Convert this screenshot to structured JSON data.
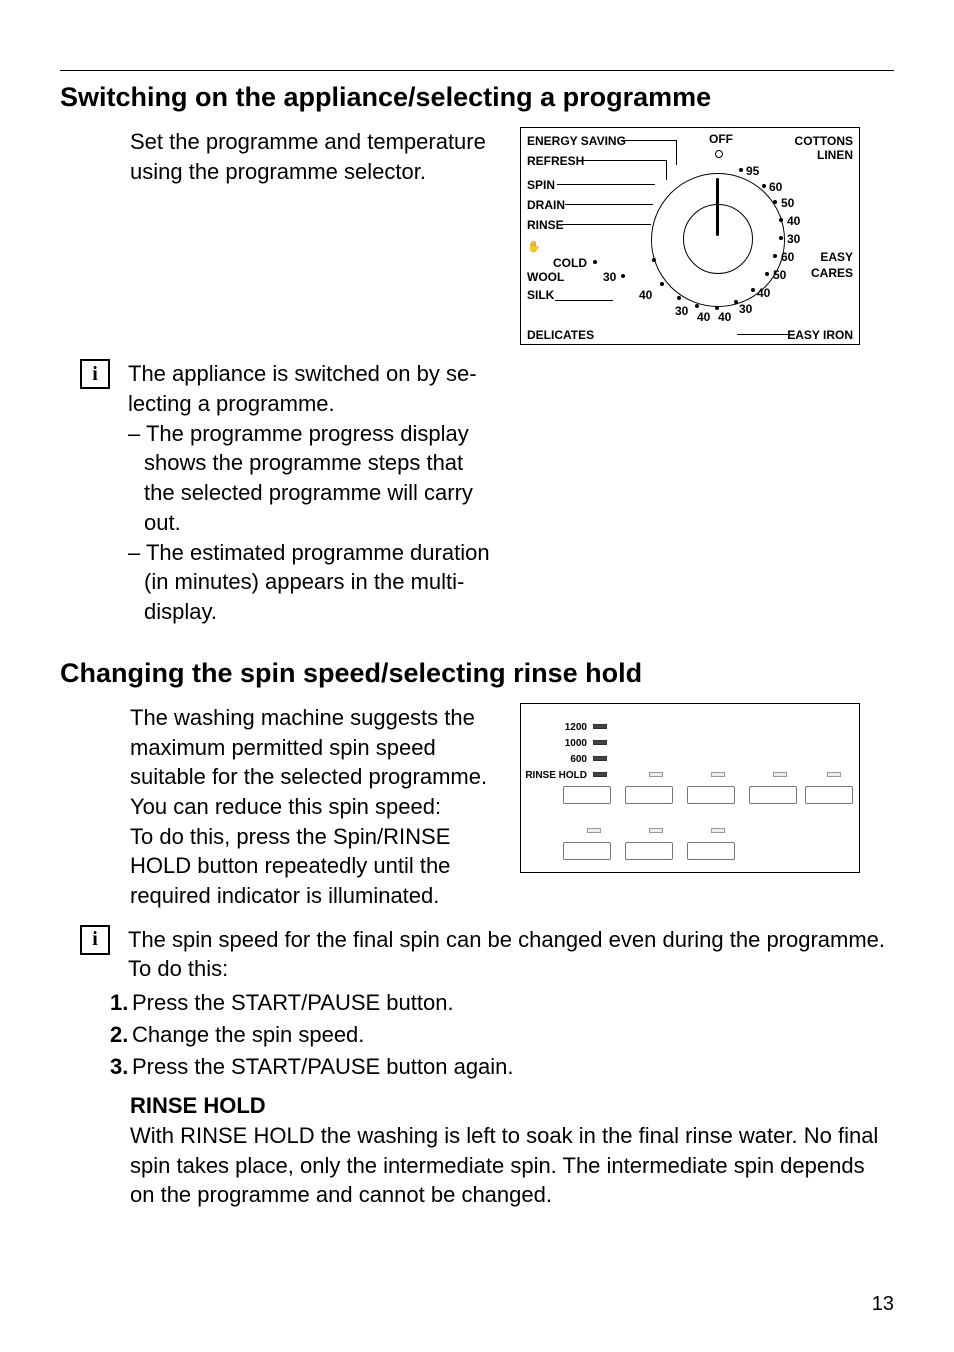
{
  "page_number": "13",
  "section1": {
    "title": "Switching on the appliance/selecting a programme",
    "intro": "Set the programme and tempera­ture using the programme selector.",
    "info_symbol": "i",
    "info_para": "The appliance is switched on by se­lecting a programme.",
    "bullets": [
      "The programme progress display shows the programme steps that the selected programme will car­ry out.",
      "The estimated programme dura­tion (in minutes) appears in the multi-display."
    ],
    "dial": {
      "off": "OFF",
      "left_labels": [
        "ENERGY SAVING",
        "REFRESH",
        "SPIN",
        "DRAIN",
        "RINSE",
        "COLD",
        "WOOL",
        "SILK",
        "DELICATES"
      ],
      "right_labels": [
        "COTTONS",
        "LINEN",
        "EASY",
        "CARES",
        "EASY IRON"
      ],
      "temps_cw": [
        "95",
        "60",
        "50",
        "40",
        "30",
        "60",
        "50",
        "40",
        "30",
        "40",
        "40",
        "30",
        "40",
        "30"
      ]
    }
  },
  "section2": {
    "title": "Changing the spin speed/selecting rinse hold",
    "intro": "The washing machine suggests the maximum permitted spin speed suitable for the selected pro­gramme. You can reduce this spin speed:",
    "intro2": "To do this, press the Spin/RINSE HOLD button repeatedly until the required indicator is illuminated.",
    "panel": {
      "speeds": [
        "1200",
        "1000",
        "600",
        "RINSE HOLD"
      ]
    },
    "info_symbol": "i",
    "info_para": "The spin speed for the final spin can be changed even during the pro­gramme. To do this:",
    "steps": [
      "Press the START/PAUSE button.",
      "Change the spin speed.",
      "Press the START/PAUSE button again."
    ],
    "rinse_hold_head": "RINSE HOLD",
    "rinse_hold_body": "With RINSE HOLD the washing is left to soak in the final rinse water. No final spin takes place, only the intermediate spin. The intermediate spin depends on the programme and cannot be changed."
  }
}
